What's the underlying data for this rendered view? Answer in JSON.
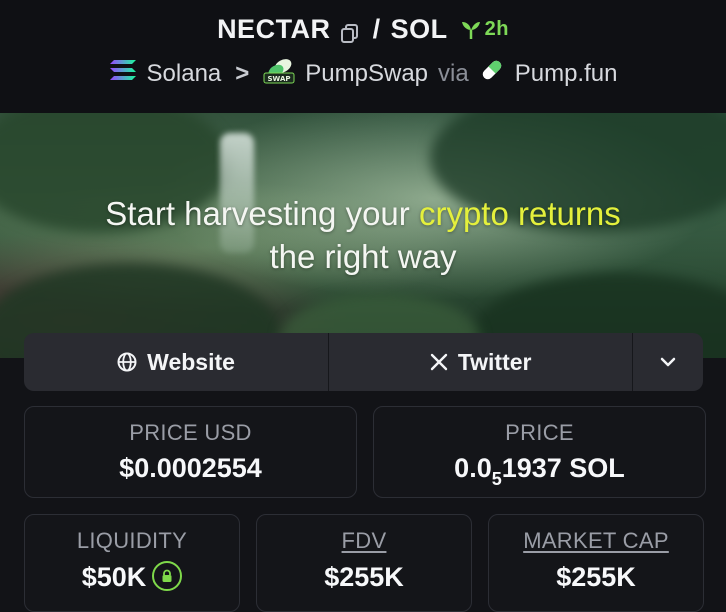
{
  "header": {
    "token": "NECTAR",
    "separator": "/",
    "quote": "SOL",
    "age": "2h",
    "chain": "Solana",
    "chevron": ">",
    "dex": "PumpSwap",
    "via": "via",
    "launchpad": "Pump.fun",
    "dex_logo_text": "SWAP"
  },
  "banner": {
    "line1_start": "Start harvesting your ",
    "line1_highlight": "crypto returns",
    "line2": "the right way"
  },
  "links": {
    "website": "Website",
    "twitter": "Twitter"
  },
  "stats": {
    "price_usd_label": "PRICE USD",
    "price_usd": "$0.0002554",
    "price_label": "PRICE",
    "price_prefix": "0.0",
    "price_sub": "5",
    "price_suffix": "1937 SOL",
    "liquidity_label": "LIQUIDITY",
    "liquidity": "$50K",
    "fdv_label": "FDV",
    "fdv": "$255K",
    "mcap_label": "MARKET CAP",
    "mcap": "$255K"
  },
  "icons": {
    "copy": "copy-icon",
    "sprout": "sprout-icon",
    "solana": "solana-logo-icon",
    "pumpswap": "pumpswap-logo-icon",
    "pumpfun": "pumpfun-pill-icon",
    "globe": "globe-icon",
    "x": "x-logo-icon",
    "chevron_down": "chevron-down-icon",
    "lock": "lock-icon"
  },
  "colors": {
    "accent_green": "#7ed957",
    "highlight_yellow": "#e4f03c",
    "background": "#121317"
  }
}
